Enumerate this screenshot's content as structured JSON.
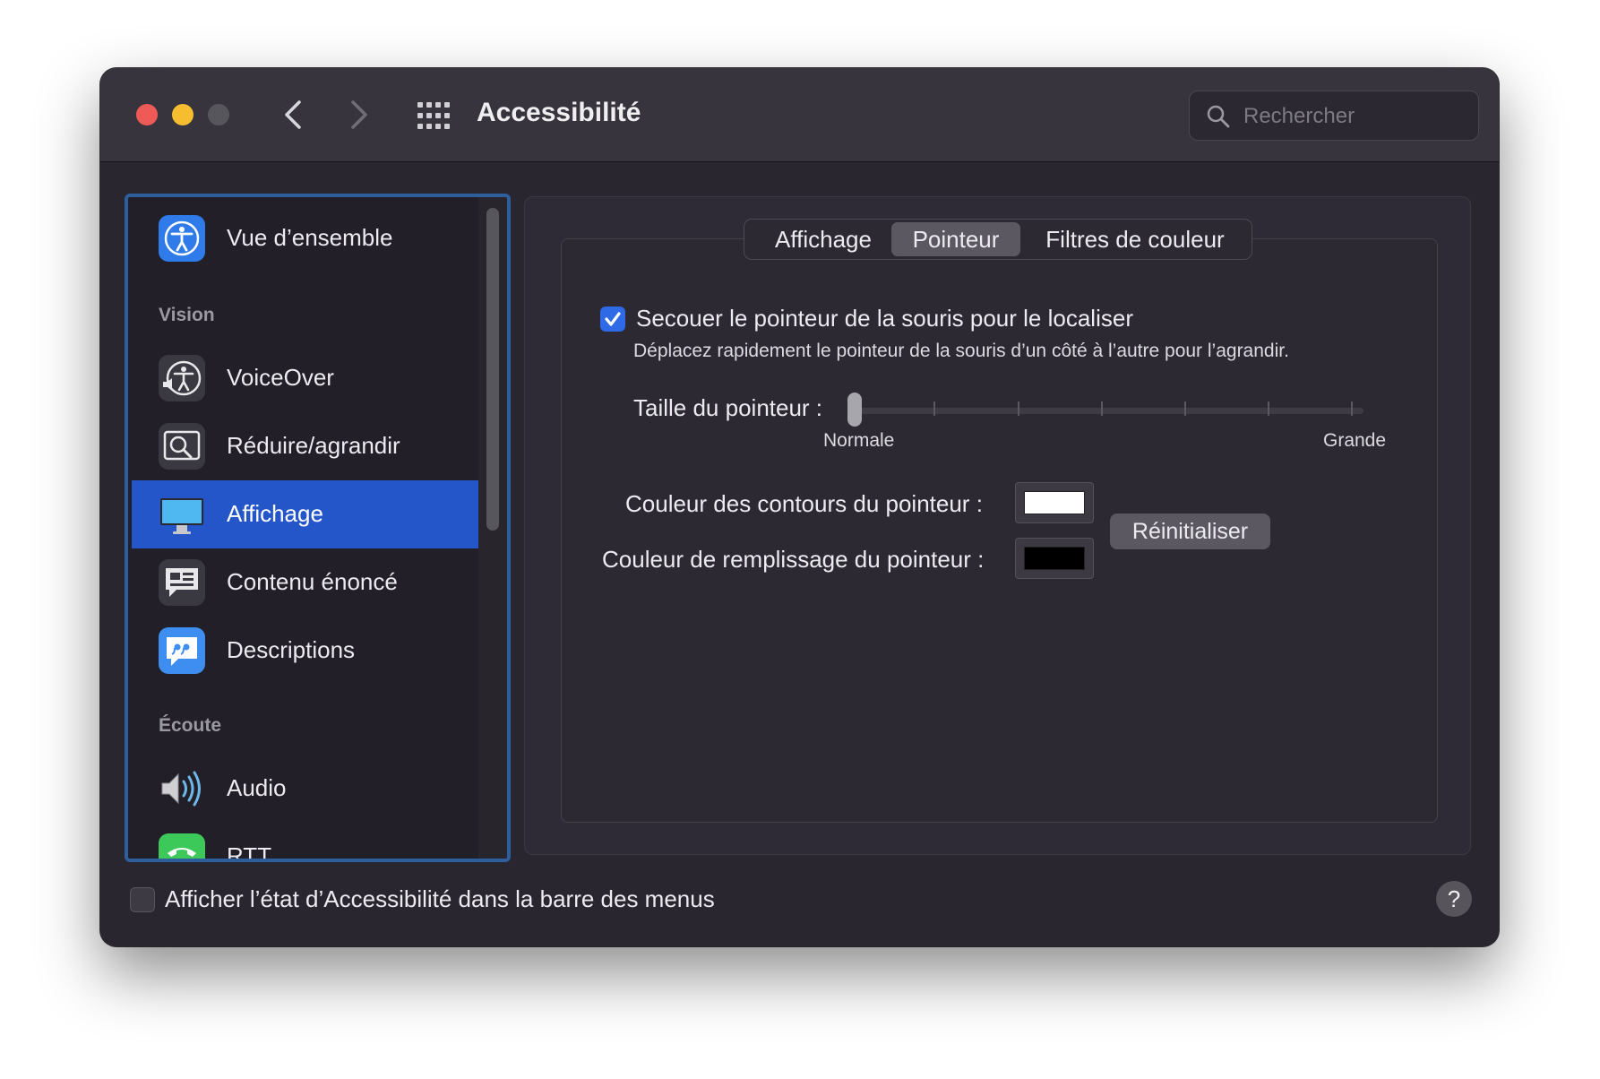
{
  "window": {
    "title": "Accessibilité",
    "search_placeholder": "Rechercher"
  },
  "sidebar": {
    "items": [
      {
        "label": "Vue d’ensemble",
        "icon": "accessibility-icon"
      },
      {
        "label": "VoiceOver",
        "icon": "voiceover-icon"
      },
      {
        "label": "Réduire/agrandir",
        "icon": "zoom-icon"
      },
      {
        "label": "Affichage",
        "icon": "display-icon",
        "selected": true
      },
      {
        "label": "Contenu énoncé",
        "icon": "spoken-content-icon"
      },
      {
        "label": "Descriptions",
        "icon": "descriptions-icon"
      },
      {
        "label": "Audio",
        "icon": "speaker-icon"
      },
      {
        "label": "RTT",
        "icon": "rtt-phone-icon"
      }
    ],
    "sections": {
      "vision": "Vision",
      "hearing": "Écoute"
    }
  },
  "tabs": [
    {
      "label": "Affichage"
    },
    {
      "label": "Pointeur",
      "selected": true
    },
    {
      "label": "Filtres de couleur"
    }
  ],
  "pointer": {
    "shake_label": "Secouer le pointeur de la souris pour le localiser",
    "shake_checked": true,
    "shake_hint": "Déplacez rapidement le pointeur de la souris d’un côté à l’autre pour l’agrandir.",
    "size_label": "Taille du pointeur :",
    "size_min_label": "Normale",
    "size_max_label": "Grande",
    "size_value": 0,
    "outline_label": "Couleur des contours du pointeur :",
    "outline_color": "#ffffff",
    "fill_label": "Couleur de remplissage du pointeur :",
    "fill_color": "#000000",
    "reset_label": "Réinitialiser"
  },
  "footer": {
    "menubar_label": "Afficher l’état d’Accessibilité dans la barre des menus",
    "menubar_checked": false,
    "help_label": "?"
  },
  "colors": {
    "accent": "#2e6ae6",
    "selection": "#2456c9"
  }
}
